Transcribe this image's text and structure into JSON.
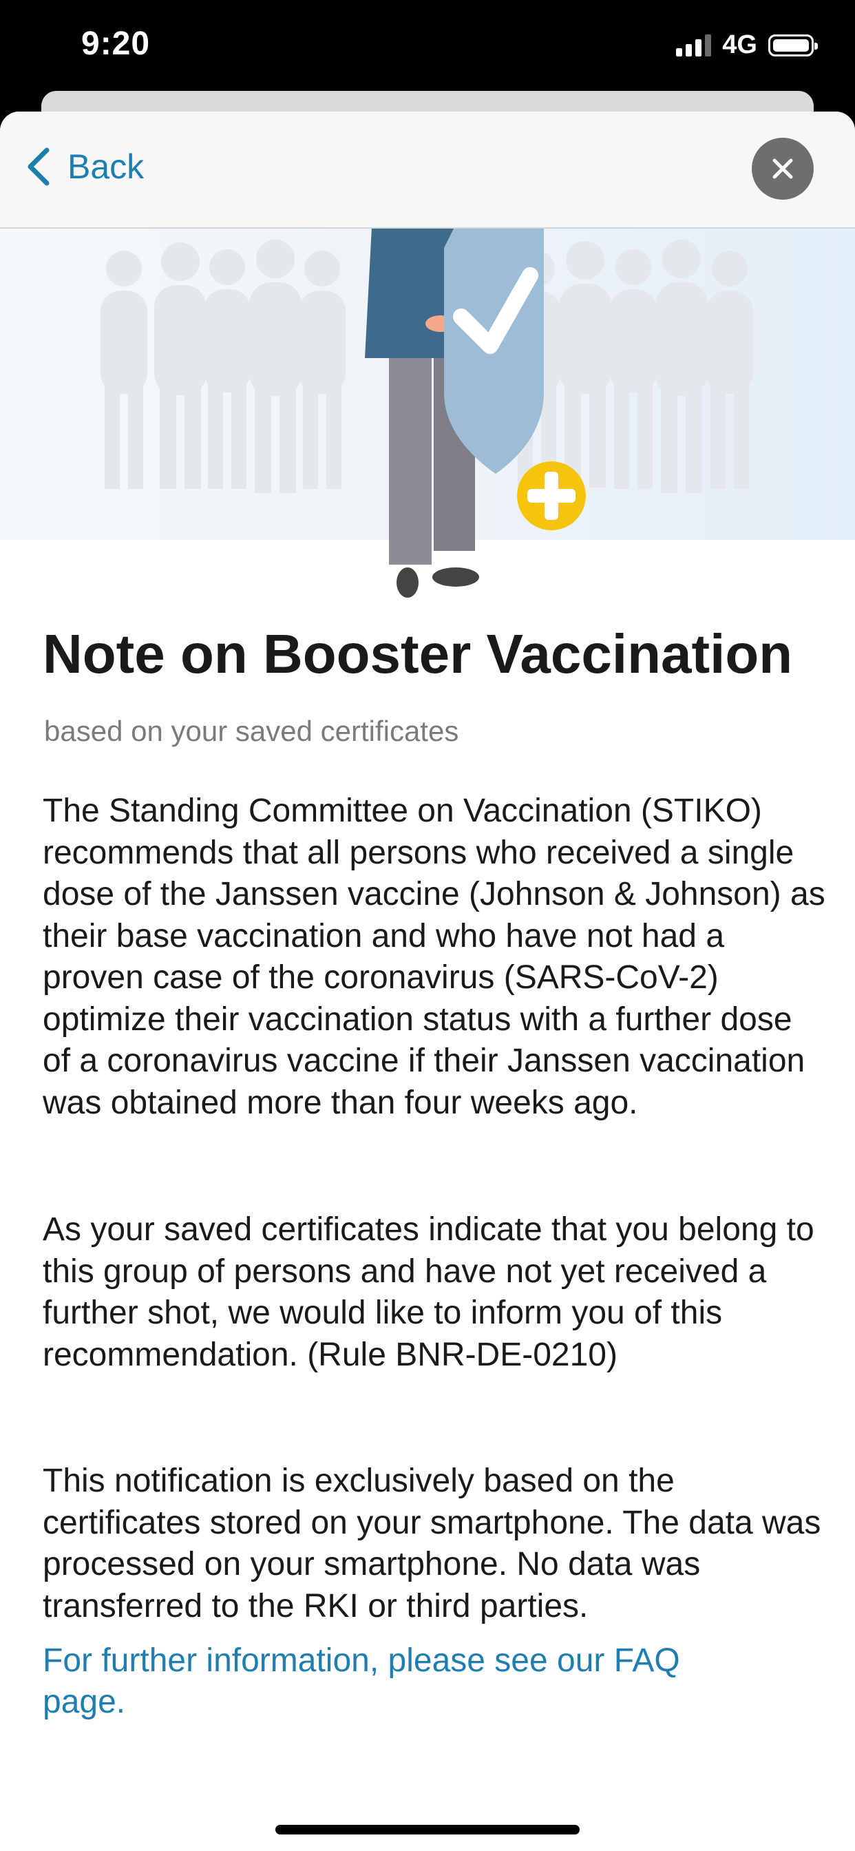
{
  "status_bar": {
    "time": "9:20",
    "network": "4G",
    "signal_icon": "cellular-signal-icon",
    "battery_icon": "battery-icon"
  },
  "nav": {
    "back_label": "Back",
    "back_icon": "chevron-left-icon",
    "close_icon": "close-icon"
  },
  "hero": {
    "illustration": "booster-vaccination-illustration",
    "icons": [
      "people-silhouettes",
      "person-figure",
      "shield-check-icon",
      "plus-badge-icon"
    ]
  },
  "content": {
    "title": "Note on Booster Vaccination",
    "subtitle": "based on your saved certificates",
    "paragraphs": [
      "The Standing Committee on Vaccination (STIKO) recommends that all persons who received a single dose of the Janssen vaccine (Johnson & Johnson) as their base vaccination and who have not had a proven case of the coronavirus (SARS-CoV-2) optimize their vaccination status with a further dose of a coronavirus vaccine if their Janssen vaccination was obtained more than four weeks ago.",
      "As your saved certificates indicate that you belong to this group of persons and have not yet received a further shot, we would like to inform you of this recommendation. (Rule BNR-DE-0210)",
      "This notification is exclusively based on the certificates stored on your smartphone. The data was processed on your smartphone. No data was transferred to the RKI or third parties."
    ],
    "faq_link": "For further information, please see our FAQ page."
  },
  "colors": {
    "accent": "#1e7eb0",
    "title": "#1a1a1a",
    "subtitle": "#7b7b7b",
    "shield": "#9dbdd6",
    "plus_badge": "#f6c40f",
    "jacket": "#3e6a8c",
    "trousers": "#8d8c95"
  }
}
